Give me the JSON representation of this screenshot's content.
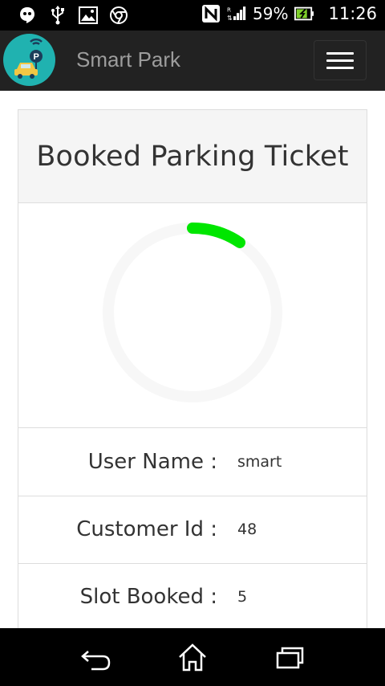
{
  "status_bar": {
    "battery_percent": "59%",
    "time": "11:26",
    "icons": [
      "hangouts-icon",
      "usb-icon",
      "gallery-icon",
      "chrome-icon",
      "nfc-icon",
      "signal-icon",
      "battery-icon"
    ]
  },
  "header": {
    "app_title": "Smart Park",
    "brand_color": "#222222",
    "logo_color": "#20b2b0"
  },
  "card": {
    "title": "Booked Parking Ticket",
    "spinner_color": "#00e600",
    "rows": [
      {
        "label": "User Name :",
        "value": "smart"
      },
      {
        "label": "Customer Id :",
        "value": "48"
      },
      {
        "label": "Slot Booked :",
        "value": "5"
      }
    ]
  },
  "nav_bar": {
    "buttons": [
      "back-icon",
      "home-icon",
      "recent-apps-icon"
    ]
  }
}
